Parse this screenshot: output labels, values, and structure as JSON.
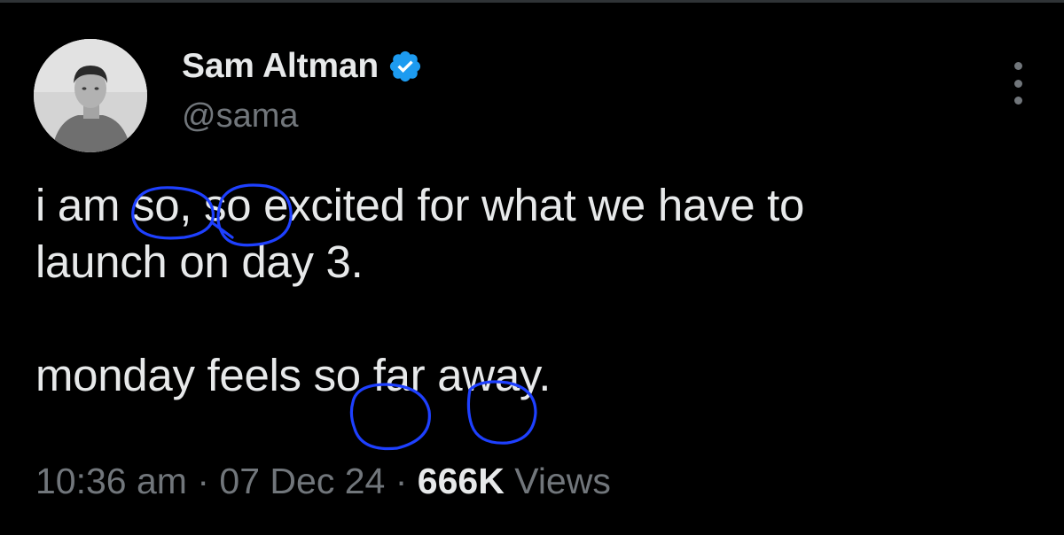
{
  "tweet": {
    "author": {
      "display_name": "Sam Altman",
      "handle": "@sama",
      "verified": true,
      "avatar_icon": "avatar-photo"
    },
    "text_lines": [
      "i am so, so excited for what we have to",
      "launch on day 3.",
      "",
      "monday feels so far away."
    ],
    "meta": {
      "time": "10:36 am",
      "separator": "·",
      "date": "07 Dec 24",
      "views_count": "666K",
      "views_label": "Views"
    },
    "more_icon": "more-options-icon"
  },
  "colors": {
    "background": "#000000",
    "primary_text": "#e7e9ea",
    "secondary_text": "#71767b",
    "verified_badge": "#1d9bf0",
    "annotation_ink": "#1e40ff"
  },
  "annotations": {
    "description": "hand-drawn blue circles",
    "icon": "circle-annotation"
  }
}
